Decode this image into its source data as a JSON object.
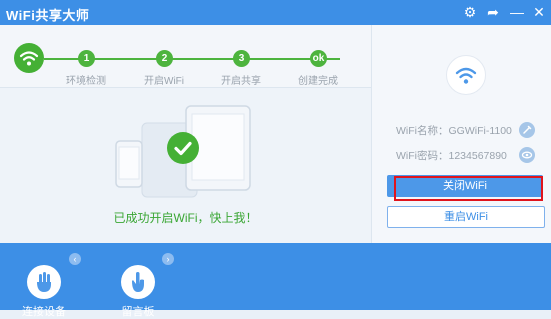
{
  "titlebar": {
    "title": "WiFi共享大师",
    "icons": [
      "gear-icon",
      "share-icon",
      "minimize-icon",
      "close-icon"
    ]
  },
  "steps": [
    {
      "number": "1",
      "label": "环境检测"
    },
    {
      "number": "2",
      "label": "开启WiFi"
    },
    {
      "number": "3",
      "label": "开启共享"
    },
    {
      "number": "ok",
      "label": "创建完成"
    }
  ],
  "main": {
    "success_message": "已成功开启WiFi，快上我！"
  },
  "info": {
    "name_label": "WiFi名称：",
    "name_value": "GGWiFi-1100",
    "password_label": "WiFi密码：",
    "password_value": "1234567890"
  },
  "buttons": {
    "close_wifi": "关闭WiFi",
    "restart_wifi": "重启WiFi"
  },
  "bottom": {
    "tools": [
      {
        "label": "连接设备",
        "icon": "hand-icon"
      },
      {
        "label": "留言板",
        "icon": "hand-pointer-icon"
      }
    ]
  },
  "colors": {
    "primary": "#3d8fe6",
    "success": "#45b035",
    "highlight": "#e0141c"
  }
}
